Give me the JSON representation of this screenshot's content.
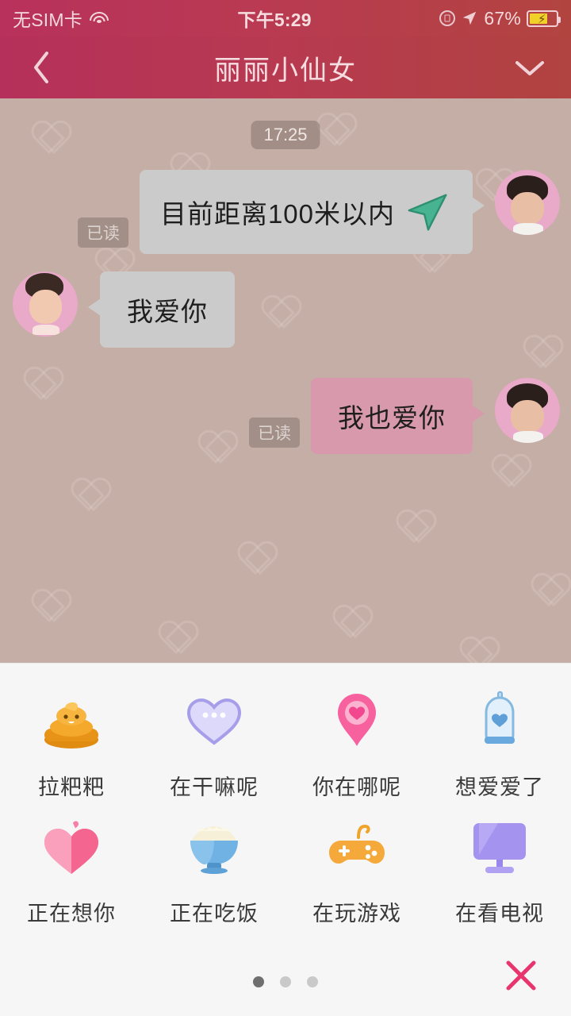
{
  "status_bar": {
    "carrier": "无SIM卡",
    "wifi_icon": "wifi-icon",
    "time": "下午5:29",
    "rotation_lock_icon": "rotation-lock-icon",
    "location_icon": "location-arrow-icon",
    "battery_percent": "67%",
    "battery_icon": "battery-charging-icon"
  },
  "nav": {
    "back_icon": "chevron-left-icon",
    "title": "丽丽小仙女",
    "more_icon": "chevron-down-icon"
  },
  "chat": {
    "timestamp": "17:25",
    "background_color": "#c5aea5",
    "messages": [
      {
        "id": "msg-location",
        "side": "outgoing",
        "text": "目前距离100米以内",
        "read_label": "已读",
        "bubble_color": "#cbcbcb",
        "icon": "navigation-arrow-icon",
        "icon_color": "#3fae8c",
        "avatar": "male-avatar"
      },
      {
        "id": "msg-love",
        "side": "incoming",
        "text": "我爱你",
        "read_label": "",
        "bubble_color": "#cbcbcb",
        "avatar": "female-avatar"
      },
      {
        "id": "msg-love-too",
        "side": "outgoing",
        "text": "我也爱你",
        "read_label": "已读",
        "bubble_color": "#d899ad",
        "avatar": "male-avatar"
      }
    ]
  },
  "panel": {
    "items": [
      {
        "label": "拉粑粑",
        "icon": "poop-icon",
        "color": "#f0a42a"
      },
      {
        "label": "在干嘛呢",
        "icon": "heart-dots-icon",
        "color": "#b9b2ef"
      },
      {
        "label": "你在哪呢",
        "icon": "map-pin-heart-icon",
        "color": "#f7619e"
      },
      {
        "label": "想爱爱了",
        "icon": "condom-heart-icon",
        "color": "#7fb8e8"
      },
      {
        "label": "正在想你",
        "icon": "heart-icon",
        "color": "#f5728f"
      },
      {
        "label": "正在吃饭",
        "icon": "rice-bowl-icon",
        "color": "#5fa8dc"
      },
      {
        "label": "在玩游戏",
        "icon": "gamepad-icon",
        "color": "#f5a93a"
      },
      {
        "label": "在看电视",
        "icon": "tv-monitor-icon",
        "color": "#9a8ae8"
      }
    ],
    "pagination": {
      "total": 3,
      "active": 1
    },
    "close_icon": "close-x-icon",
    "close_color": "#e8356d"
  }
}
